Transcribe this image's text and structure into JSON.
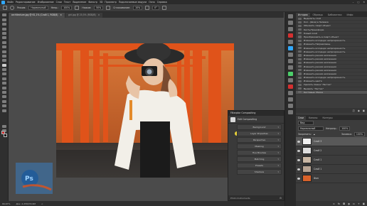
{
  "menubar": {
    "items": [
      "Файл",
      "Редактирование",
      "Изображение",
      "Слои",
      "Текст",
      "Выделение",
      "Фильтр",
      "3D",
      "Просмотр",
      "Подключаемые модули",
      "Окно",
      "Справка"
    ]
  },
  "options": {
    "mode_label": "Режим:",
    "mode_value": "Нормальный",
    "opacity_label": "Непр.:",
    "opacity_value": "100%",
    "flow_label": "Нажим:",
    "flow_value": "50%",
    "smooth_label": "Сглаживание:",
    "smooth_value": "10%",
    "angle_value": "0°"
  },
  "tabs": [
    {
      "label": "architecture.jpg @ 61,1% (Слой 1, RGB/8)",
      "active": true
    },
    {
      "label": "girl.jpg @ 20,5% (RGB/8)",
      "active": false
    }
  ],
  "status": {
    "zoom": "66,67%",
    "doc": "Док: 2,25M/33,6M",
    "slot": "<"
  },
  "history": {
    "tabs": [
      {
        "label": "История",
        "active": true
      },
      {
        "label": "Образцы",
        "active": false
      },
      {
        "label": "Библиотеки",
        "active": false
      },
      {
        "label": "Инфо",
        "active": false
      }
    ],
    "items": [
      "Выделить слой",
      "Кол - (Шов) в Заливка",
      "Обновить смарт-объект",
      "Кисть/Трансформ.",
      "Новый Слой",
      "Преобразовать в смарт-объект",
      "Изменить исходную непрозрачность",
      "Изменить Направляющ.",
      "Изменить исходную непрозрачность",
      "Изменить исходную непрозрачность",
      "Изменить режим наложения",
      "Изменить режим наложения",
      "Изменить режим наложения",
      "Изменить режим наложения",
      "Изменить режим наложения",
      "Изменить режим наложения",
      "Изменить исходную непрозрачность",
      "Изменить цвета",
      "Удалить Смена \"Ластик\"",
      "Вызвать \"Ластик\"",
      "Кистевые: Маска"
    ],
    "selected_index": 20
  },
  "layers": {
    "tabs": [
      {
        "label": "Слои",
        "active": true
      },
      {
        "label": "Каналы",
        "active": false
      },
      {
        "label": "Контуры",
        "active": false
      }
    ],
    "filter_value": "Вид",
    "mode_value": "Нормальный",
    "opacity_label": "Непрозр.:",
    "opacity_value": "100%",
    "lock_label": "Закрепить:",
    "fill_label": "Заливка:",
    "fill_value": "100%",
    "items": [
      {
        "name": "Слой 3",
        "selected": true
      },
      {
        "name": "Слой 2",
        "selected": false
      },
      {
        "name": "Слой 1",
        "selected": false
      },
      {
        "name": "Слой 1",
        "selected": false
      },
      {
        "name": "Фон",
        "selected": false
      }
    ]
  },
  "filter_panel": {
    "title": "Filtarptor Compositing",
    "sub": "Edit Compositing",
    "rows": [
      "Background",
      "Layer Properties",
      "Perspective",
      "Masking",
      "Hue Brushes",
      "Matching",
      "Presets",
      "Shadows"
    ],
    "footer": "Photo Instruments"
  },
  "colors": {
    "accent": "#31a8ff",
    "fg_swatch": "#d42020",
    "bg_swatch": "#1a1a1a"
  }
}
